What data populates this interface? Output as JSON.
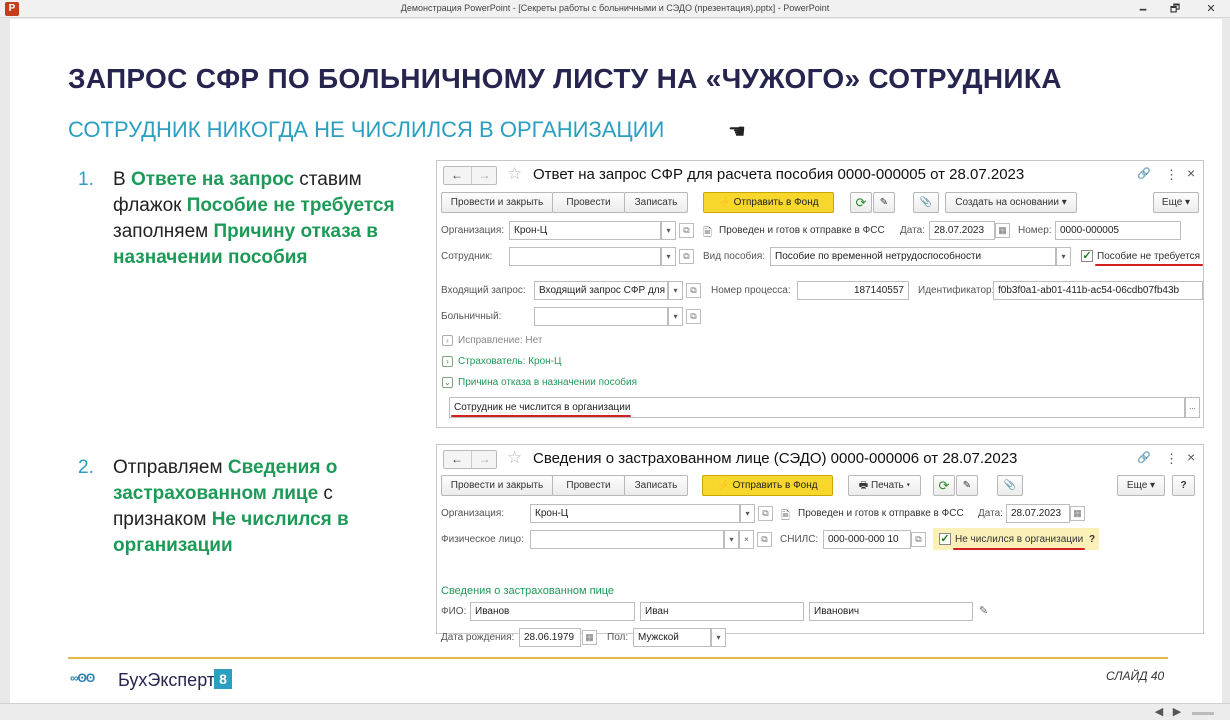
{
  "window": {
    "title": "Демонстрация PowerPoint - [Секреты работы с больничными и СЭДО (презентация).pptx] - PowerPoint",
    "icon": "powerpoint-icon",
    "minimize": "🗕",
    "maximize": "🗗",
    "close": "✕"
  },
  "slide": {
    "title": "ЗАПРОС СФР ПО БОЛЬНИЧНОМУ ЛИСТУ НА «ЧУЖОГО» СОТРУДНИКА",
    "subtitle": "СОТРУДНИК НИКОГДА НЕ ЧИСЛИЛСЯ В ОРГАНИЗАЦИИ",
    "cursor_icon": "☚",
    "steps": [
      {
        "num": "1.",
        "parts": [
          "В ",
          "Ответе на запрос",
          " ставим флажок ",
          "Пособие не требуется",
          " заполняем ",
          "Причину отказа в назначении пособия"
        ]
      },
      {
        "num": "2.",
        "parts": [
          "Отправляем ",
          "Сведения о застрахованном лице",
          " с признаком ",
          "Не числился в организации"
        ]
      }
    ],
    "slide_number": "СЛАЙД 40",
    "logo": {
      "mark": "∞ʘʘ",
      "name": "БухЭксперт",
      "badge": "8"
    }
  },
  "form1": {
    "nav_back": "←",
    "nav_fwd": "→",
    "star": "☆",
    "title": "Ответ на запрос СФР для расчета пособия 0000-000005 от 28.07.2023",
    "link_icon": "🔗",
    "more_icon": "⋮",
    "close_icon": "×",
    "buttons": {
      "post_close": "Провести и закрыть",
      "post": "Провести",
      "save": "Записать",
      "send": "Отправить в Фонд",
      "create_based": "Создать на основании",
      "more": "Еще"
    },
    "org_label": "Организация:",
    "org_value": "Крон-Ц",
    "ready_label": "Проведен и готов к отправке в ФСС",
    "date_label": "Дата:",
    "date_value": "28.07.2023",
    "number_label": "Номер:",
    "number_value": "0000-000005",
    "employee_label": "Сотрудник:",
    "employee_value": "",
    "benefit_type_label": "Вид пособия:",
    "benefit_type_value": "Пособие по временной нетрудоспособности",
    "not_required_label": "Пособие не требуется",
    "not_required_checked": true,
    "incoming_label": "Входящий запрос:",
    "incoming_value": "Входящий запрос СФР для",
    "process_label": "Номер процесса:",
    "process_value": "187140557",
    "id_label": "Идентификатор:",
    "id_value": "f0b3f0a1-ab01-411b-ac54-06cdb07fb43b",
    "sick_label": "Больничный:",
    "sick_value": "",
    "correction_label": "Исправление: Нет",
    "insurer_label": "Страхователь: Крон-Ц",
    "refusal_label": "Причина отказа в назначении пособия",
    "refusal_text": "Сотрудник не числится в организации",
    "ellipsis": "..."
  },
  "form2": {
    "nav_back": "←",
    "nav_fwd": "→",
    "star": "☆",
    "title": "Сведения о застрахованном лице (СЭДО) 0000-000006 от 28.07.2023",
    "link_icon": "🔗",
    "more_icon": "⋮",
    "close_icon": "×",
    "buttons": {
      "post_close": "Провести и закрыть",
      "post": "Провести",
      "save": "Записать",
      "send": "Отправить в Фонд",
      "print": "Печать",
      "more": "Еще",
      "help": "?"
    },
    "org_label": "Организация:",
    "org_value": "Крон-Ц",
    "ready_label": "Проведен и готов к отправке в ФСС",
    "date_label": "Дата:",
    "date_value": "28.07.2023",
    "person_label": "Физическое лицо:",
    "person_value": "",
    "snils_label": "СНИЛС:",
    "snils_value": "000-000-000 10",
    "not_employed_label": "Не числился в организации",
    "not_employed_checked": true,
    "help_mark": "?",
    "section_title": "Сведения о застрахованном пице",
    "fio_label": "ФИО:",
    "last_name": "Иванов",
    "first_name": "Иван",
    "middle_name": "Иванович",
    "birth_label": "Дата рождения:",
    "birth_value": "28.06.1979",
    "gender_label": "Пол:",
    "gender_value": "Мужской"
  },
  "colors": {
    "title": "#26254f",
    "accent": "#2a9fc1",
    "green": "#1e9a58",
    "yellow_button": "#f7d72c",
    "underline": "#d21f1f",
    "footer_line": "#e4b84a"
  }
}
